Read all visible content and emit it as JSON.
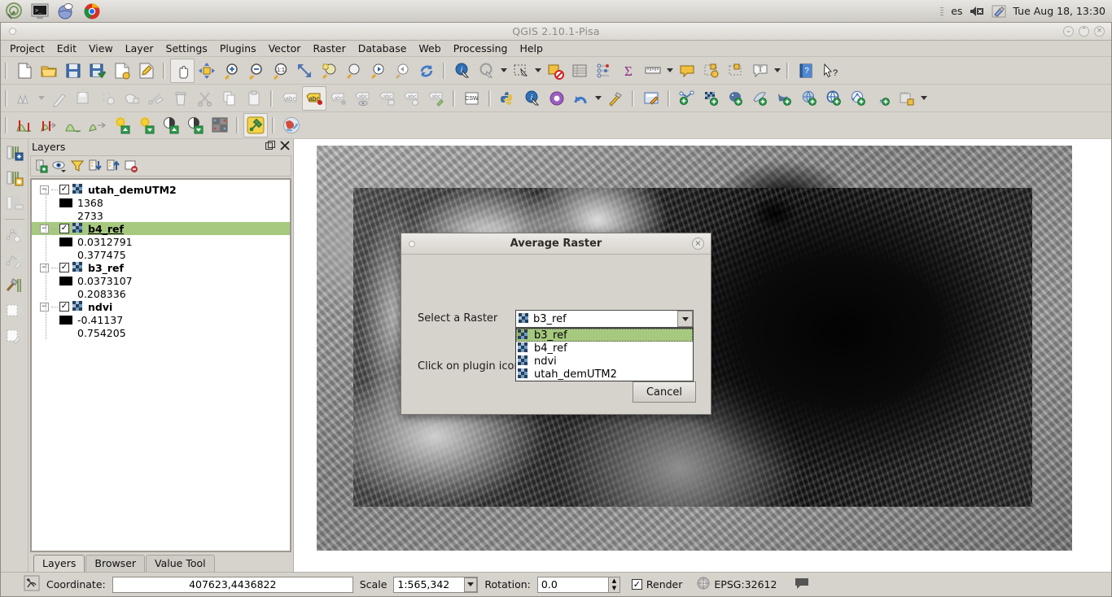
{
  "desktop": {
    "launcher_icons": [
      "qgis-launcher-icon",
      "terminal-icon",
      "help-browser-icon",
      "chrome-icon"
    ],
    "keyboard_layout": "es",
    "volume_icon": "volume-muted-icon",
    "tools_icon": "screwdriver-icon",
    "clock": "Tue Aug 18, 13:30"
  },
  "window": {
    "title": "QGIS 2.10.1-Pisa",
    "minimize": "⌄",
    "maximize": "⌃",
    "close": "×"
  },
  "menubar": {
    "items": [
      {
        "label": "Project"
      },
      {
        "label": "Edit"
      },
      {
        "label": "View"
      },
      {
        "label": "Layer"
      },
      {
        "label": "Settings"
      },
      {
        "label": "Plugins"
      },
      {
        "label": "Vector"
      },
      {
        "label": "Raster"
      },
      {
        "label": "Database"
      },
      {
        "label": "Web"
      },
      {
        "label": "Processing"
      },
      {
        "label": "Help"
      }
    ]
  },
  "toolbars": {
    "row1": [
      "new-project-icon",
      "open-project-icon",
      "save-project-icon",
      "save-project-as-icon",
      "new-print-composer-icon",
      "composer-manager-icon",
      "pan-map-icon",
      "pan-to-selection-icon",
      "zoom-in-icon",
      "zoom-out-icon",
      "zoom-native-icon",
      "zoom-full-icon",
      "zoom-to-selection-icon",
      "zoom-to-layer-icon",
      "zoom-last-icon",
      "zoom-next-icon",
      "refresh-icon",
      "identify-features-icon",
      "map-tips-icon",
      "select-features-icon",
      "deselect-features-icon",
      "open-attribute-table-icon",
      "field-calculator-icon",
      "statistics-icon",
      "measure-line-icon",
      "show-map-tips-icon",
      "new-bookmark-icon",
      "show-bookmarks-icon",
      "text-annotation-icon",
      "help-contents-icon",
      "whats-this-icon"
    ],
    "row2": [
      "current-edits-icon",
      "toggle-editing-icon",
      "save-layer-edits-icon",
      "add-feature-icon",
      "move-feature-icon",
      "node-tool-icon",
      "delete-selected-icon",
      "cut-features-icon",
      "copy-features-icon",
      "paste-features-icon",
      "label-icon",
      "highlight-labels-icon",
      "pin-labels-icon",
      "show-hide-labels-icon",
      "move-label-icon",
      "rotate-label-icon",
      "change-label-icon",
      "csw-icon",
      "python-console-icon",
      "metasearch-icon",
      "processing-toolbox-icon",
      "undo-icon",
      "plugin-builder-icon",
      "osm-editor-icon",
      "add-vector-layer-icon",
      "add-raster-layer-icon",
      "add-postgis-layer-icon",
      "add-spatialite-layer-icon",
      "add-mssql-layer-icon",
      "add-wms-layer-icon",
      "add-wcs-layer-icon",
      "add-wfs-layer-icon",
      "add-delimited-text-icon",
      "new-memory-layer-icon"
    ],
    "row3": [
      "stretch-histogram-icon",
      "stretch-current-extent-icon",
      "cumulative-cut-stretch-icon",
      "local-cumulative-stretch-icon",
      "increase-brightness-icon",
      "decrease-brightness-icon",
      "increase-contrast-icon",
      "decrease-contrast-icon",
      "raster-calculator-icon",
      "plugin-average-raster-icon",
      "openlayers-plugin-icon"
    ],
    "left_vertical": [
      "add-db-layer-icon",
      "db-manager-icon",
      "db-remove-icon",
      "network-analysis-icon",
      "network-edit-icon",
      "geoprocessing-icon",
      "layout-icon",
      "layout-edit-icon"
    ]
  },
  "layers_panel": {
    "title": "Layers",
    "float_icon": "undock-icon",
    "close_icon": "close-icon",
    "toolbar_icons": [
      "add-group-icon",
      "manage-layer-visibility-icon",
      "filter-legend-icon",
      "expand-all-icon",
      "collapse-all-icon",
      "remove-layer-icon"
    ],
    "layers": [
      {
        "name": "utah_demUTM2",
        "checked": true,
        "selected": false,
        "min": "1368",
        "max": "2733"
      },
      {
        "name": "b4_ref",
        "checked": true,
        "selected": true,
        "min": "0.0312791",
        "max": "0.377475"
      },
      {
        "name": "b3_ref",
        "checked": true,
        "selected": false,
        "min": "0.0373107",
        "max": "0.208336"
      },
      {
        "name": "ndvi",
        "checked": true,
        "selected": false,
        "min": "-0.41137",
        "max": "0.754205"
      }
    ],
    "tabs": [
      {
        "label": "Layers",
        "active": true
      },
      {
        "label": "Browser",
        "active": false
      },
      {
        "label": "Value Tool",
        "active": false
      }
    ]
  },
  "dialog": {
    "title": "Average Raster",
    "close_label": "×",
    "raster_label": "Select a Raster",
    "selected_raster": "b3_ref",
    "hint_text": "Click on plugin icon",
    "cancel_label": "Cancel",
    "options": [
      {
        "label": "b3_ref",
        "highlighted": true
      },
      {
        "label": "b4_ref",
        "highlighted": false
      },
      {
        "label": "ndvi",
        "highlighted": false
      },
      {
        "label": "utah_demUTM2",
        "highlighted": false
      }
    ]
  },
  "statusbar": {
    "toggle_icon": "toggle-extents-icon",
    "coordinate_label": "Coordinate:",
    "coordinate_value": "407623,4436822",
    "scale_label": "Scale",
    "scale_value": "1:565,342",
    "rotation_label": "Rotation:",
    "rotation_value": "0.0",
    "render_label": "Render",
    "render_checked": true,
    "crs_label": "EPSG:32612",
    "crs_icon": "crs-globe-icon",
    "messages_icon": "messages-bubble-icon"
  },
  "colors": {
    "selection_green": "#a6c97f",
    "window_bg": "#d6d2cc",
    "dialog_bg": "#d6d2cc"
  }
}
